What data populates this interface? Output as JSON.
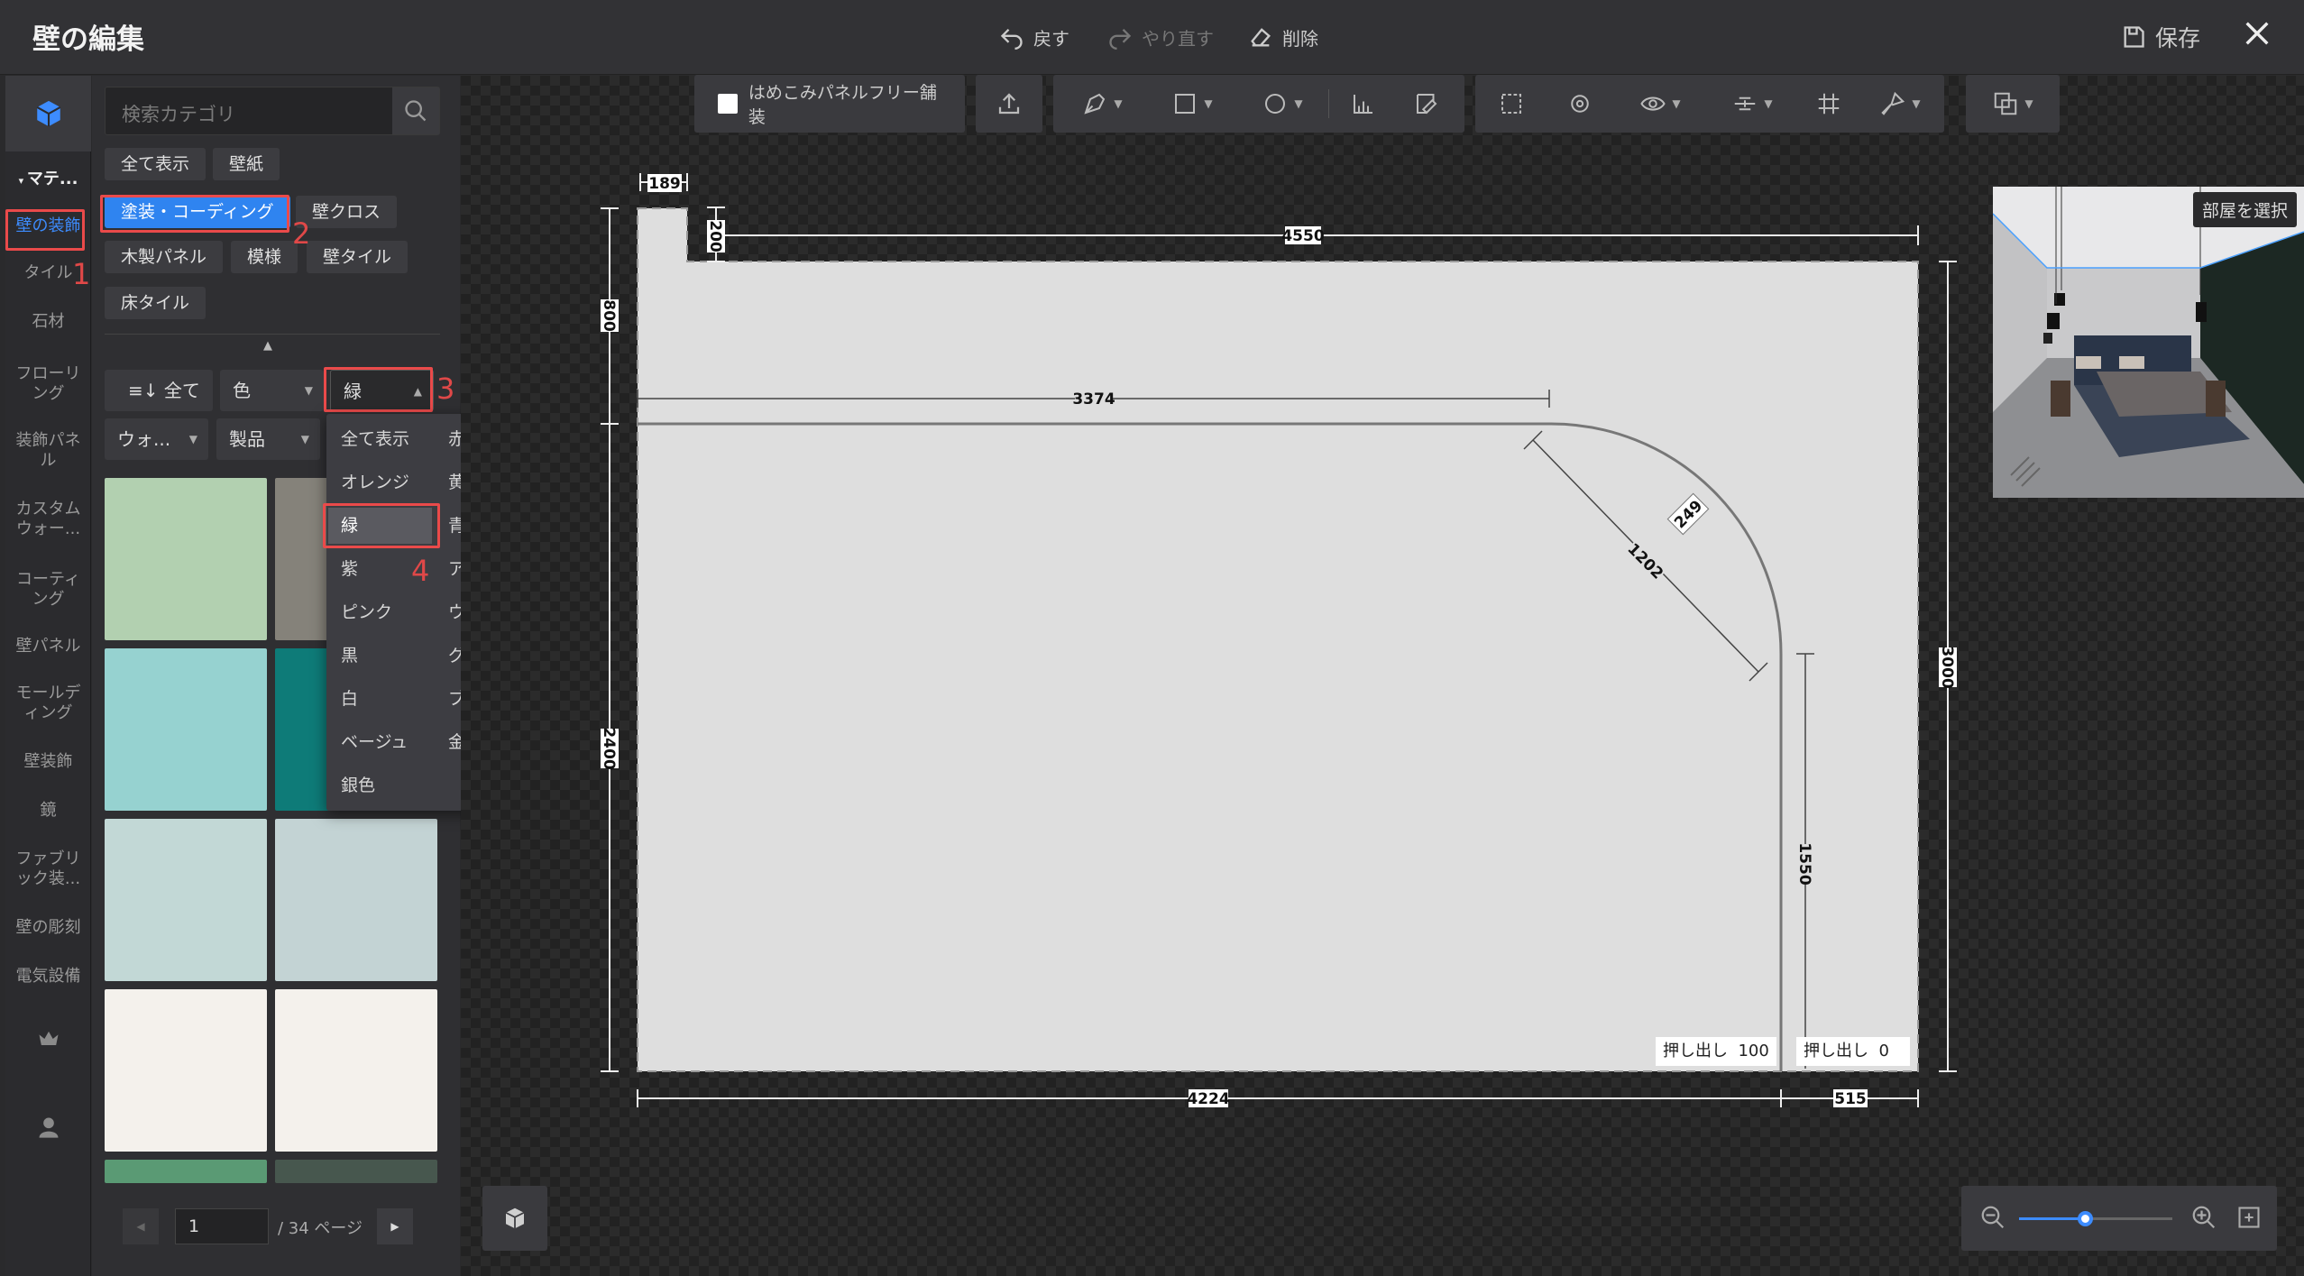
{
  "header": {
    "title": "壁の編集",
    "undo": "戻す",
    "redo": "やり直す",
    "delete": "削除",
    "save": "保存"
  },
  "rail": {
    "section": "マテ...",
    "items": [
      {
        "label": "壁の装飾",
        "active": true
      },
      {
        "label": "タイル"
      },
      {
        "label": "石材"
      },
      {
        "label": "フローリング"
      },
      {
        "label": "装飾パネル"
      },
      {
        "label": "カスタムウォー..."
      },
      {
        "label": "コーティング"
      },
      {
        "label": "壁パネル"
      },
      {
        "label": "モールディング"
      },
      {
        "label": "壁装飾"
      },
      {
        "label": "鏡"
      },
      {
        "label": "ファブリック装..."
      },
      {
        "label": "壁の彫刻"
      },
      {
        "label": "電気設備"
      }
    ]
  },
  "panel": {
    "search_placeholder": "検索カテゴリ",
    "tags": [
      "全て表示",
      "壁紙",
      "塗装・コーディング",
      "壁クロス",
      "木製パネル",
      "模様",
      "壁タイル",
      "床タイル"
    ],
    "filters": {
      "all": "全て",
      "color": "色",
      "color_value": "緑",
      "wall": "ウォ...",
      "product": "製品"
    },
    "swatches": [
      "#b2d0b0",
      "#85827a",
      "#96d2d0",
      "#0e7b78",
      "#c2d8d6",
      "#c3d3d4",
      "#f4f1ec",
      "#f4f1ec",
      "#5a9a74",
      "#47574e"
    ],
    "pager": {
      "page": "1",
      "total": "/ 34 ページ"
    }
  },
  "color_menu": {
    "items": [
      [
        "全て表示",
        "赤"
      ],
      [
        "オレンジ",
        "黄"
      ],
      [
        "緑",
        "青"
      ],
      [
        "紫",
        "アースカ..."
      ],
      [
        "ピンク",
        "ウッドカ..."
      ],
      [
        "黒",
        "グレー"
      ],
      [
        "白",
        "ブラウン"
      ],
      [
        "ベージュ",
        "金色"
      ],
      [
        "銀色",
        ""
      ]
    ],
    "selected": "緑"
  },
  "annotations": [
    "1",
    "2",
    "3",
    "4"
  ],
  "toolbar": {
    "checkbox_label": "はめこみパネルフリー舗装"
  },
  "dimensions": {
    "top_notch": "189",
    "notch_h": "200",
    "top_width": "4550",
    "left_upper": "800",
    "left_lower": "2400",
    "inner_width": "3374",
    "radius_small": "249",
    "radius": "1202",
    "right_height": "3000",
    "inner_vertical": "1550",
    "bottom_left": "4224",
    "bottom_right": "515"
  },
  "extrude": {
    "left_label": "押し出し",
    "left_value": "100",
    "right_label": "押し出し",
    "right_value": "0"
  },
  "preview": {
    "room_button": "部屋を選択"
  },
  "zoom": {
    "level": 0.43
  }
}
